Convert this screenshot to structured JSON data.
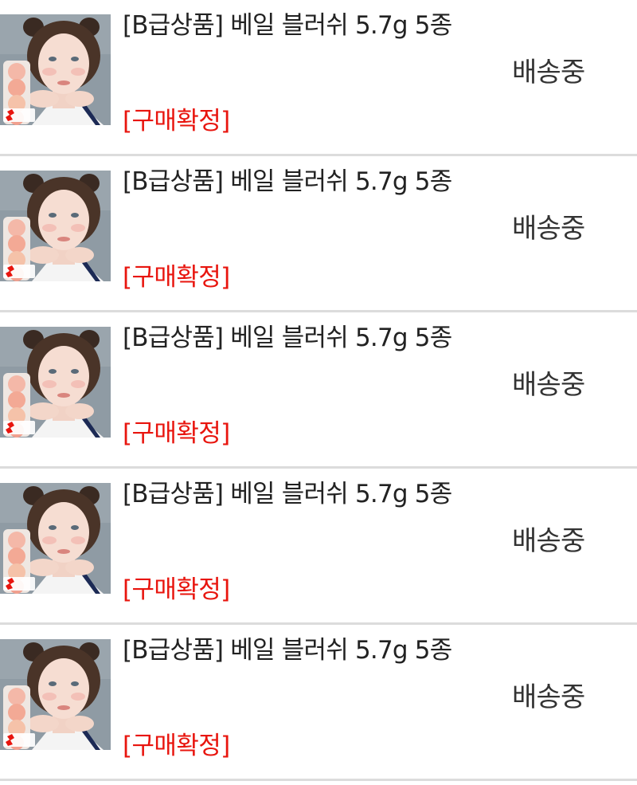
{
  "orders": [
    {
      "title": "[B급상품] 베일 블러쉬 5.7g 5종",
      "action_label": "[구매확정]",
      "status": "배송중",
      "badge": "Shorts",
      "badge_icon": "shorts-icon"
    },
    {
      "title": "[B급상품] 베일 블러쉬 5.7g 5종",
      "action_label": "[구매확정]",
      "status": "배송중",
      "badge": "Shorts",
      "badge_icon": "shorts-icon"
    },
    {
      "title": "[B급상품] 베일 블러쉬 5.7g 5종",
      "action_label": "[구매확정]",
      "status": "배송중",
      "badge": "Shorts",
      "badge_icon": "shorts-icon"
    },
    {
      "title": "[B급상품] 베일 블러쉬 5.7g 5종",
      "action_label": "[구매확정]",
      "status": "배송중",
      "badge": "Shorts",
      "badge_icon": "shorts-icon"
    },
    {
      "title": "[B급상품] 베일 블러쉬 5.7g 5종",
      "action_label": "[구매확정]",
      "status": "배송중",
      "badge": "Shorts",
      "badge_icon": "shorts-icon"
    }
  ],
  "colors": {
    "action_red": "#e8150e",
    "text": "#222222",
    "divider": "#dcdcdc"
  }
}
